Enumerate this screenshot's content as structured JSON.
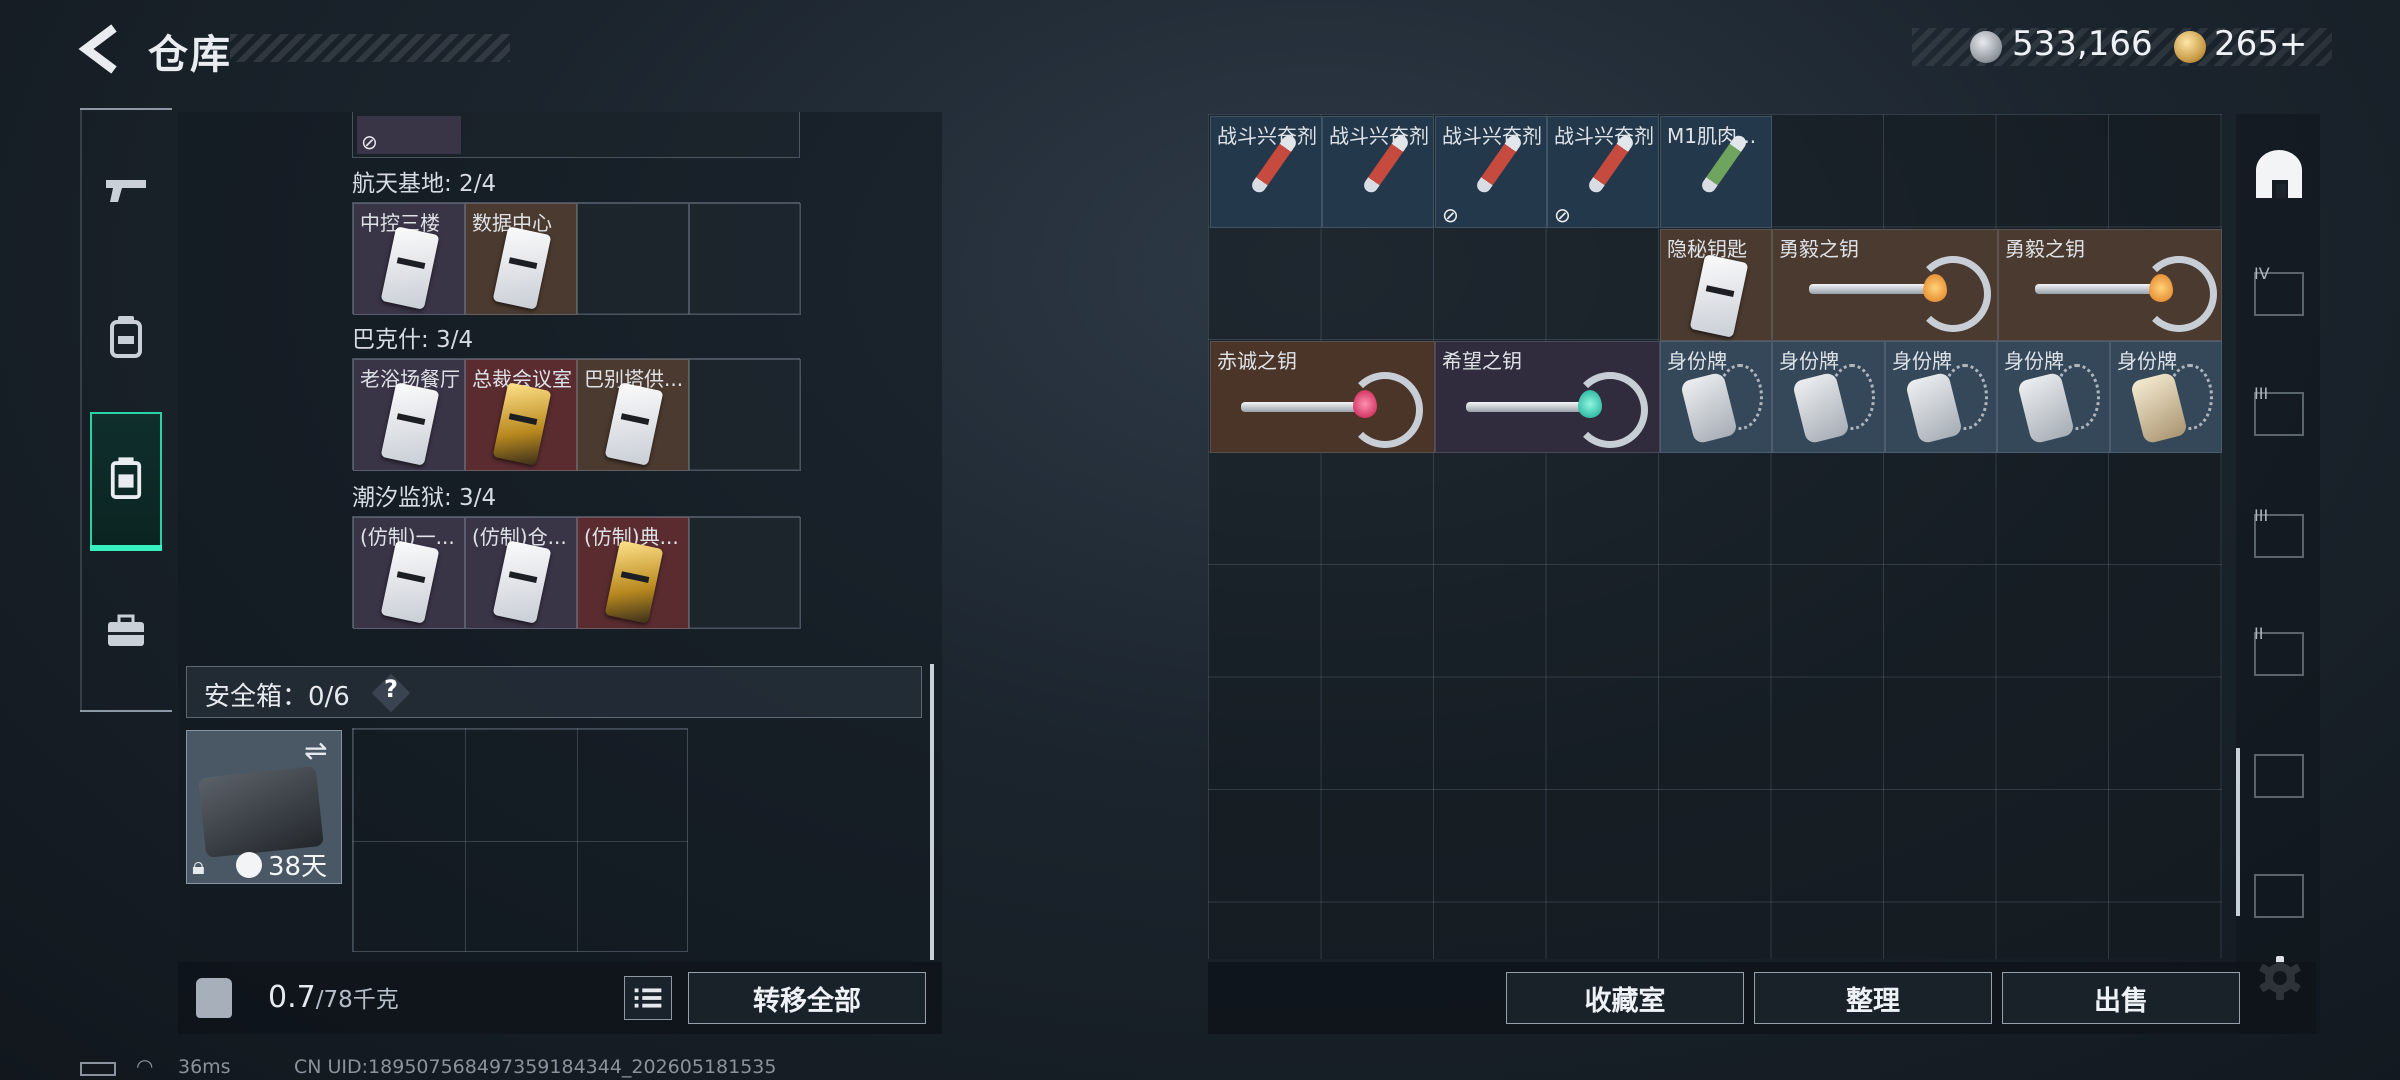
{
  "header": {
    "title": "仓库",
    "silver": "533,166",
    "gold": "265",
    "gold_plus": "+"
  },
  "left_nav": [
    "gun-icon",
    "backpack-icon",
    "container-icon",
    "toolbox-icon"
  ],
  "left_panel": {
    "top_partial_slot": {
      "icon": "no-link-icon"
    },
    "groups": [
      {
        "title": "航天基地: 2/4",
        "slots": [
          {
            "label": "中控三楼",
            "card": "white",
            "bg": "purple"
          },
          {
            "label": "数据中心",
            "card": "white",
            "bg": "brown"
          }
        ]
      },
      {
        "title": "巴克什: 3/4",
        "slots": [
          {
            "label": "老浴场餐厅",
            "card": "white",
            "bg": "purple"
          },
          {
            "label": "总裁会议室",
            "card": "gold",
            "bg": "red"
          },
          {
            "label": "巴别塔供...",
            "card": "white",
            "bg": "brown"
          }
        ]
      },
      {
        "title": "潮汐监狱: 3/4",
        "slots": [
          {
            "label": "(仿制)一...",
            "card": "white",
            "bg": "purple"
          },
          {
            "label": "(仿制)仓...",
            "card": "white",
            "bg": "purple"
          },
          {
            "label": "(仿制)典...",
            "card": "gold",
            "bg": "red"
          }
        ]
      }
    ],
    "safe_box": {
      "label": "安全箱：0/6",
      "help": "?",
      "days": "38天"
    },
    "weight": {
      "current": "0.7",
      "max": "/78千克"
    },
    "transfer_all": "转移全部"
  },
  "right_grid": {
    "row1": [
      {
        "label": "战斗兴奋剂",
        "type": "syringe-red",
        "bg": "blue",
        "nolink": false
      },
      {
        "label": "战斗兴奋剂",
        "type": "syringe-red",
        "bg": "blue",
        "nolink": false
      },
      {
        "label": "战斗兴奋剂",
        "type": "syringe-red",
        "bg": "blue",
        "nolink": true
      },
      {
        "label": "战斗兴奋剂",
        "type": "syringe-red",
        "bg": "blue",
        "nolink": true
      },
      {
        "label": "M1肌肉...",
        "type": "syringe-green",
        "bg": "blue",
        "nolink": false
      }
    ],
    "row2": [
      {
        "label": "隐秘钥匙",
        "type": "card",
        "bg": "brown",
        "span": 1
      },
      {
        "label": "勇毅之钥",
        "type": "key-orange",
        "bg": "brown",
        "span": 2
      },
      {
        "label": "勇毅之钥",
        "type": "key-orange",
        "bg": "brown",
        "span": 2
      }
    ],
    "row3": [
      {
        "label": "赤诚之钥",
        "type": "key-red",
        "bg": "rust",
        "span": 2
      },
      {
        "label": "希望之钥",
        "type": "key-teal",
        "bg": "violet",
        "span": 2
      },
      {
        "label": "身份牌",
        "type": "tag",
        "bg": "slate",
        "span": 1
      },
      {
        "label": "身份牌",
        "type": "tag",
        "bg": "slate",
        "span": 1
      },
      {
        "label": "身份牌",
        "type": "tag",
        "bg": "slate",
        "span": 1
      },
      {
        "label": "身份牌",
        "type": "tag",
        "bg": "slate",
        "span": 1
      },
      {
        "label": "身份牌",
        "type": "tag-gold",
        "bg": "slate",
        "span": 1
      }
    ]
  },
  "right_sidebar": {
    "icons": [
      {
        "name": "home-icon",
        "roman": ""
      },
      {
        "name": "folder-icon",
        "roman": "IV"
      },
      {
        "name": "rack-icon",
        "roman": "III"
      },
      {
        "name": "crate-icon",
        "roman": "III"
      },
      {
        "name": "rack-icon",
        "roman": "II"
      },
      {
        "name": "crate-icon",
        "roman": ""
      },
      {
        "name": "crate-icon",
        "roman": ""
      }
    ]
  },
  "buttons": {
    "collection": "收藏室",
    "sort": "整理",
    "sell": "出售"
  },
  "status": {
    "ping": "36ms",
    "uid": "CN UID:189507568497359184344_202605181535"
  },
  "colors": {
    "accent": "#2ad1a7",
    "panel": "#1b242d"
  }
}
